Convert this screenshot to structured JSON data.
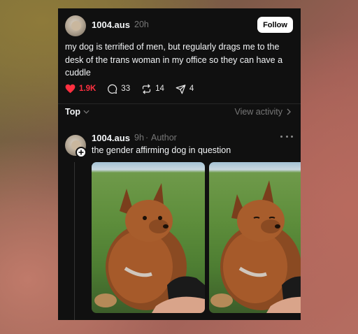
{
  "post": {
    "username": "1004.aus",
    "time": "20h",
    "follow_label": "Follow",
    "text": "my dog is terrified of men, but regularly drags me to the desk of the trans woman in my office so they can have a cuddle",
    "likes": "1.9K",
    "comments": "33",
    "reposts": "14",
    "shares": "4"
  },
  "sort": {
    "label": "Top",
    "view_activity": "View activity"
  },
  "reply": {
    "username": "1004.aus",
    "time": "9h",
    "author_tag": "Author",
    "text": "the gender affirming dog in question"
  },
  "icons": {
    "like": "heart-icon",
    "comment": "comment-icon",
    "repost": "repost-icon",
    "share": "send-icon",
    "more": "more-icon",
    "chevron": "chevron-down-icon",
    "arrow": "chevron-right-icon"
  },
  "colors": {
    "card_bg": "#101010",
    "like_red": "#ff3040",
    "muted": "#777777"
  }
}
